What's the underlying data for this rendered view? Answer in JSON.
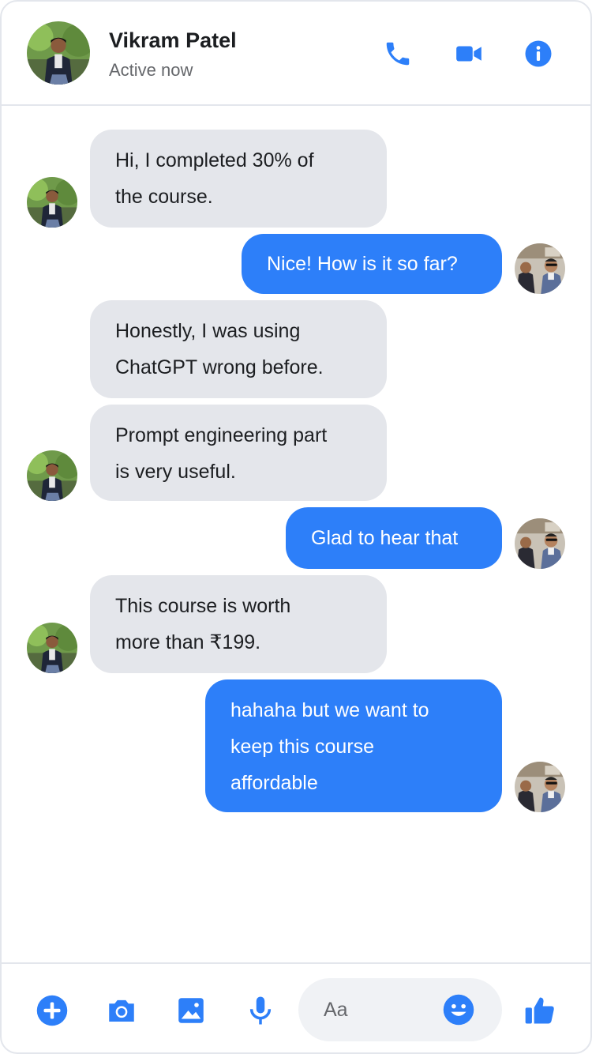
{
  "header": {
    "name": "Vikram Patel",
    "status": "Active now",
    "icons": [
      "phone-icon",
      "video-icon",
      "info-icon"
    ]
  },
  "messages": [
    {
      "from": "contact",
      "lines": [
        "Hi, I completed 30% of",
        "the course."
      ]
    },
    {
      "from": "me",
      "lines": [
        "Nice! How is it so far?"
      ]
    },
    {
      "from": "contact",
      "lines": [
        "Honestly, I was using",
        "ChatGPT wrong before."
      ]
    },
    {
      "from": "contact",
      "lines": [
        "Prompt engineering part",
        "is very useful."
      ]
    },
    {
      "from": "me",
      "lines": [
        "Glad to hear that"
      ]
    },
    {
      "from": "contact",
      "lines": [
        "This course is worth",
        "more than ₹199."
      ]
    },
    {
      "from": "me",
      "lines": [
        "hahaha but we want to",
        "keep this course",
        "affordable"
      ]
    }
  ],
  "composer": {
    "placeholder": "Aa",
    "icons": [
      "plus-icon",
      "camera-icon",
      "image-icon",
      "microphone-icon",
      "emoji-icon",
      "thumbs-up-icon"
    ]
  },
  "colors": {
    "accent": "#2d7ff9",
    "incoming_bubble": "#e4e6eb",
    "border": "#e3e6ec"
  }
}
